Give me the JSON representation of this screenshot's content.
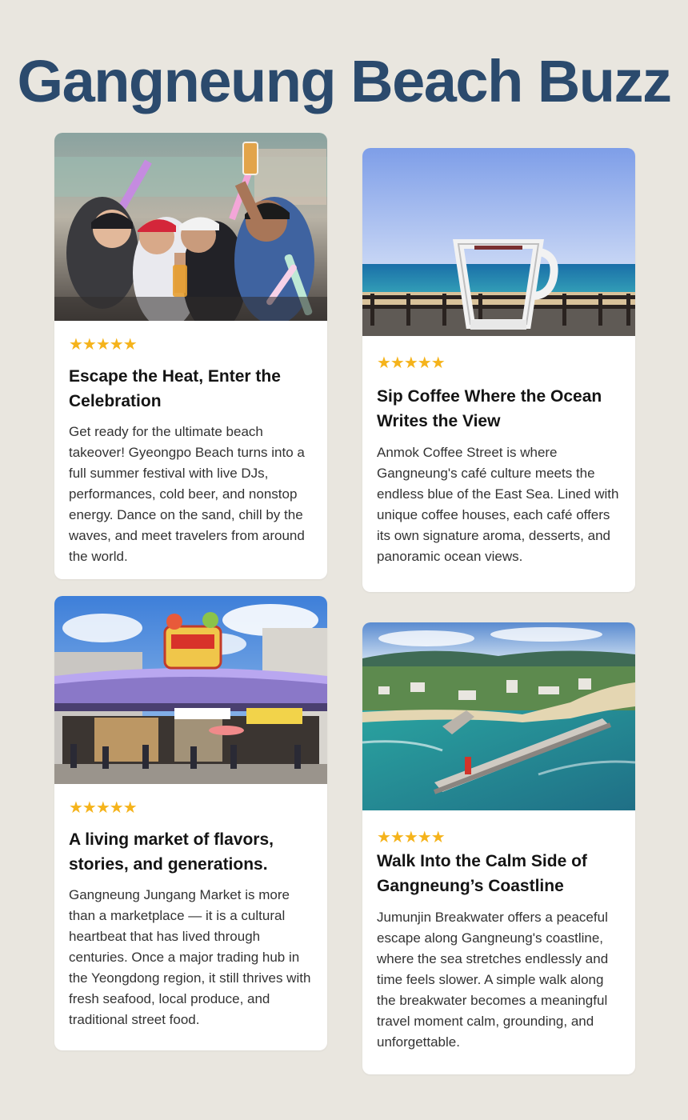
{
  "page": {
    "title": "Gangneung Beach Buzz"
  },
  "colors": {
    "background": "#e9e6df",
    "title": "#2b4a6d",
    "star": "#f5b31b",
    "card": "#ffffff"
  },
  "cards": [
    {
      "image_icon": "festival-crowd-photo",
      "rating": "★★★★★",
      "title": "Escape the Heat, Enter the Celebration",
      "body": "Get ready for the ultimate beach takeover! Gyeongpo Beach turns into a full summer festival with live DJs, performances, cold beer, and nonstop energy. Dance on the sand, chill by the waves, and meet travelers from around the world."
    },
    {
      "image_icon": "coffee-cup-sculpture-photo",
      "rating": "★★★★★",
      "title": "Sip Coffee Where the Ocean Writes the View",
      "body": "Anmok Coffee Street is where Gangneung's café culture meets the endless blue of the East Sea. Lined with unique coffee houses, each café offers its own signature aroma, desserts, and panoramic ocean views."
    },
    {
      "image_icon": "market-entrance-photo",
      "rating": "★★★★★",
      "title": "A living market of flavors, stories, and generations.",
      "body": "Gangneung Jungang Market is more than a marketplace — it is a cultural heartbeat that has lived through centuries. Once a major trading hub in the Yeongdong region, it still thrives with fresh seafood, local produce, and traditional street food."
    },
    {
      "image_icon": "breakwater-aerial-photo",
      "rating": "★★★★★",
      "title": "Walk Into the Calm Side of Gangneung’s Coastline",
      "body": "Jumunjin Breakwater offers a peaceful escape along Gangneung's coastline, where the sea stretches endlessly and time feels slower. A simple walk along the breakwater becomes a meaningful travel moment calm, grounding, and unforgettable."
    }
  ]
}
